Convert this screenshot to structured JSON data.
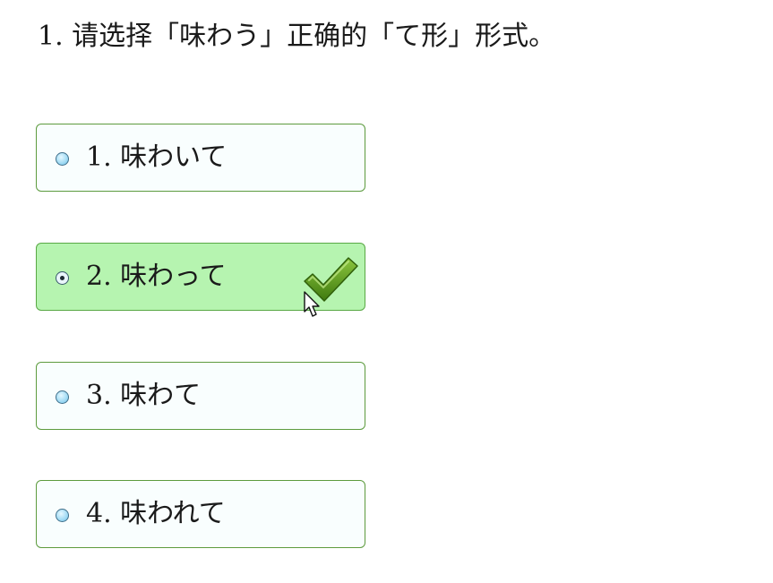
{
  "question": {
    "text": "1. 请选择「味わう」正确的「て形」形式。"
  },
  "options": [
    {
      "label": "1. 味わいて",
      "selected": false,
      "correct": false
    },
    {
      "label": "2. 味わって",
      "selected": true,
      "correct": true
    },
    {
      "label": "3. 味わて",
      "selected": false,
      "correct": false
    },
    {
      "label": "4. 味われて",
      "selected": false,
      "correct": false
    }
  ],
  "colors": {
    "option_border": "#5d9b3e",
    "option_background": "#f9fefe",
    "selected_background": "#b6f4b0",
    "checkmark": "#5c9a12",
    "radio_fill": "#a6ddf5"
  },
  "icons": {
    "correct_indicator": "checkmark-icon",
    "pointer": "mouse-cursor-icon"
  }
}
